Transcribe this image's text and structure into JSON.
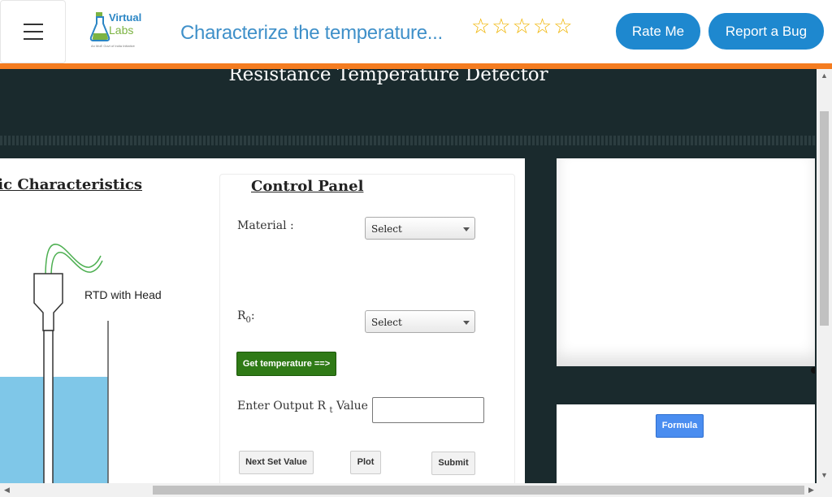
{
  "header": {
    "title": "Characterize the temperature...",
    "logo": {
      "line1": "Virtual",
      "line2": "Labs",
      "tagline": "An MoE Govt of India Initiative"
    },
    "stars": "☆☆☆☆☆",
    "rate_label": "Rate Me",
    "bug_label": "Report a Bug"
  },
  "page": {
    "heading": "Resistance Temperature Detector",
    "section_title": "Static Characteristics",
    "rtd_label": "RTD with Head"
  },
  "control_panel": {
    "title": "Control Panel",
    "material_label": "Material :",
    "material_value": "Select",
    "r0_label": "R",
    "r0_sub": "0",
    "r0_suffix": ":",
    "r0_value": "Select",
    "get_temp_label": "Get temperature ==>",
    "output_label_pre": "Enter Output R",
    "output_label_sub": "t",
    "output_label_post": " Value :",
    "output_value": "",
    "next_label": "Next Set Value",
    "plot_label": "Plot",
    "submit_label": "Submit"
  },
  "side": {
    "formula_label": "Formula"
  },
  "colors": {
    "accent": "#1e88cf",
    "header_bar": "#f47c20",
    "background": "#1a2a2d",
    "water": "#7fc7e8",
    "green_button": "#2f7a16",
    "formula_button": "#4a8df0"
  }
}
